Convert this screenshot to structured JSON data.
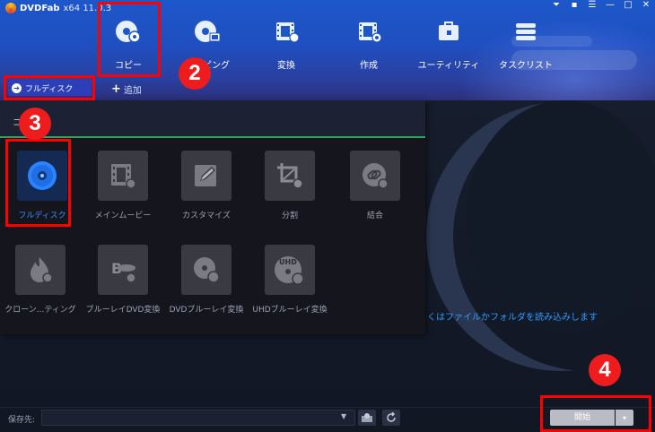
{
  "app": {
    "name": "DVDFab",
    "version_label": "x64  11.0.3"
  },
  "window_controls": [
    "⏷",
    "▪",
    "☰",
    "—",
    "□",
    "✕"
  ],
  "nav": [
    {
      "label": "コピー",
      "icon": "disc-copy-icon"
    },
    {
      "label": "リッピング",
      "icon": "disc-ripper-icon"
    },
    {
      "label": "変換",
      "icon": "film-convert-icon"
    },
    {
      "label": "作成",
      "icon": "film-create-icon"
    },
    {
      "label": "ユーティリティ",
      "icon": "toolbox-icon"
    },
    {
      "label": "タスクリスト",
      "icon": "tasklist-icon"
    }
  ],
  "toolbar": {
    "mode_label": "フルディスク",
    "add_label": "追加"
  },
  "panel": {
    "title": "コピー",
    "modes": [
      {
        "label": "フルディスク",
        "icon": "disc-icon",
        "active": true
      },
      {
        "label": "メインムービー",
        "icon": "film-icon",
        "active": false
      },
      {
        "label": "カスタマイズ",
        "icon": "edit-icon",
        "active": false
      },
      {
        "label": "分割",
        "icon": "crop-icon",
        "active": false
      },
      {
        "label": "結合",
        "icon": "link-icon",
        "active": false
      },
      {
        "label": "クローン...ティング",
        "icon": "flame-icon",
        "active": false
      },
      {
        "label": "ブルーレイDVD変換",
        "icon": "bluray-icon",
        "active": false
      },
      {
        "label": "DVDブルーレイ変換",
        "icon": "dvd-bluray-icon",
        "active": false
      },
      {
        "label": "UHDブルーレイ変換",
        "icon": "uhd-disc-icon",
        "active": false
      }
    ]
  },
  "hint_text": "くはファイルかフォルダを読み込みします",
  "footer": {
    "save_label": "保存先:",
    "save_value": "",
    "start_label": "開始"
  },
  "markers": [
    "2",
    "3",
    "4"
  ],
  "colors": {
    "accent": "#2d3fb8",
    "annotation": "#ff0000",
    "hint": "#2f9bff",
    "active_tile": "#3e8cff"
  }
}
